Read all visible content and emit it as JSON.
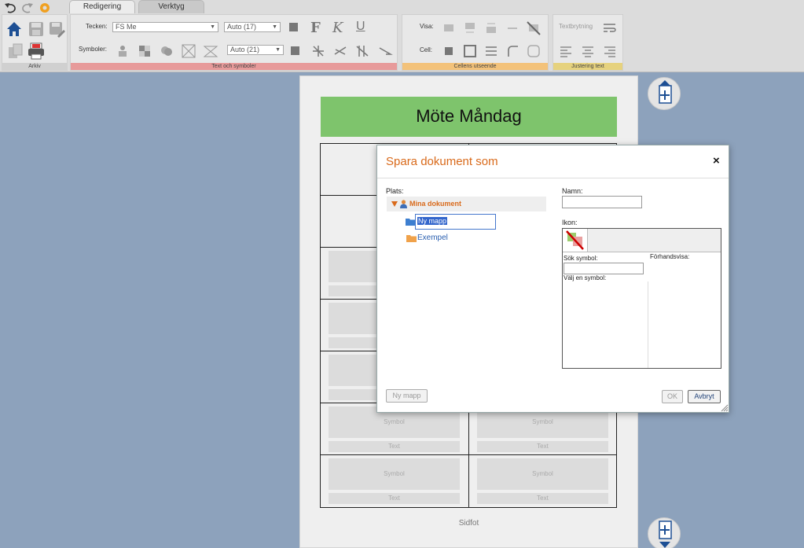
{
  "ribbon": {
    "tabs": [
      "Redigering",
      "Verktyg"
    ],
    "arkiv_label": "Arkiv",
    "tecken_label": "Tecken:",
    "font_value": "FS Me",
    "font_size_value": "Auto (17)",
    "symboler_label": "Symboler:",
    "symbol_size_value": "Auto (21)",
    "bold_label": "F",
    "italic_label": "K",
    "underline_label": "U",
    "text_symbols_group": "Text och symboler",
    "visa_label": "Visa:",
    "cell_label": "Cell:",
    "cell_appearance_group": "Cellens utseende",
    "textbrytning_label": "Textbrytning",
    "justering_group": "Justering text",
    "colors": {
      "text_group": "#e79a9a",
      "cell_group": "#f3c27a",
      "justering_group": "#e6d27e",
      "arkiv_group": "#d0d0d0"
    }
  },
  "document": {
    "title": "Möte Måndag",
    "title_color": "#7ec46c",
    "cell_symbol_placeholder": "Symbol",
    "cell_text_placeholder": "Text",
    "footer": "Sidfot"
  },
  "dialog": {
    "title": "Spara dokument som",
    "close": "×",
    "plats_label": "Plats:",
    "root_folder": "Mina dokument",
    "new_folder_value": "Ny mapp",
    "subfolder": "Exempel",
    "namn_label": "Namn:",
    "name_value": "",
    "ikon_label": "Ikon:",
    "sok_symbol_label": "Sök symbol:",
    "forhandsvisa_label": "Förhandsvisa:",
    "valj_symbol_label": "Välj en symbol:",
    "new_folder_button": "Ny mapp",
    "ok_button": "OK",
    "cancel_button": "Avbryt",
    "accent_color": "#d96a1b"
  }
}
